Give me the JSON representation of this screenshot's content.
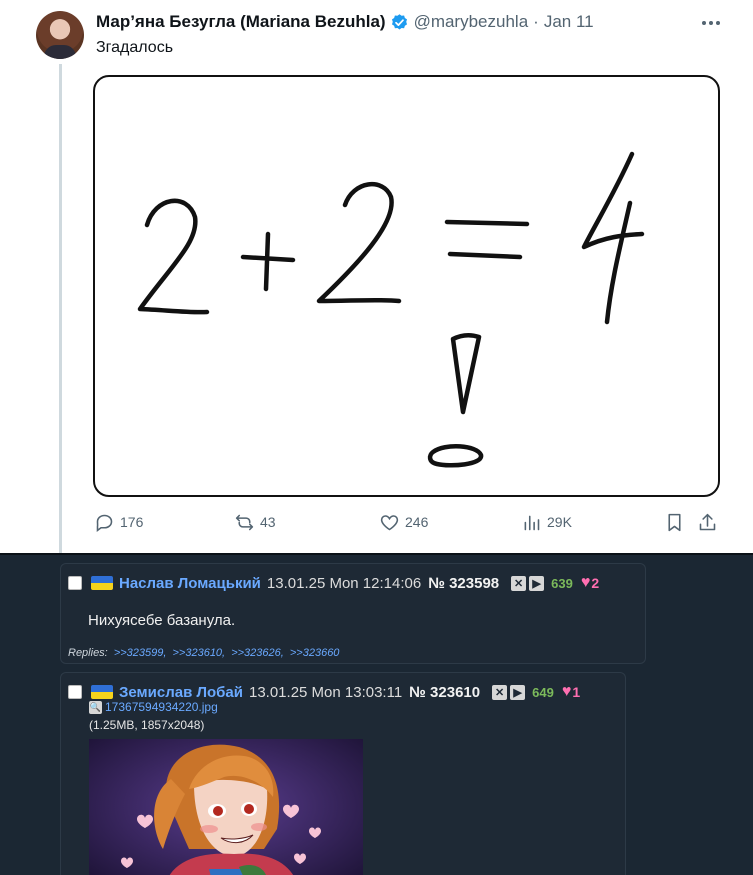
{
  "tweet": {
    "author_name": "Мар’яна Безугла (Mariana Bezuhla)",
    "handle": "@marybezuhla",
    "separator": "·",
    "date": "Jan 11",
    "text": "Згадалось",
    "image_drawing": "2+2=4 !",
    "stats": {
      "replies": "176",
      "reposts": "43",
      "likes": "246",
      "views": "29K"
    },
    "icons": {
      "reply": "reply-icon",
      "repost": "repost-icon",
      "like": "heart-icon",
      "views": "views-icon",
      "bookmark": "bookmark-icon",
      "share": "share-icon",
      "verified": "verified-badge-icon",
      "more": "more-icon"
    },
    "accent": "#1d9bf0"
  },
  "board": {
    "posts": [
      {
        "name": "Наслав Ломацький",
        "date": "13.01.25 Mon 12:14:06",
        "number": "№ 323598",
        "count": "639",
        "likes": "2",
        "text": "Нихуясебе базанула.",
        "replies_label": "Replies:",
        "replies": [
          ">>323599,",
          ">>323610,",
          ">>323626,",
          ">>323660"
        ]
      },
      {
        "name": "Земислав Лобай",
        "date": "13.01.25 Mon 13:03:11",
        "number": "№ 323610",
        "count": "649",
        "likes": "1",
        "file_name": "17367594934220.jpg",
        "file_meta": "(1.25MB, 1857x2048)"
      }
    ],
    "button_glyphs": {
      "hide": "✕",
      "play": "▶",
      "heart": "♥",
      "search": "🔍"
    },
    "flag_colors": [
      "#2f6fd6",
      "#f6d31c"
    ],
    "colors": {
      "name": "#6aa9ff",
      "count": "#7cba5b",
      "heart": "#ff6fb1"
    }
  }
}
